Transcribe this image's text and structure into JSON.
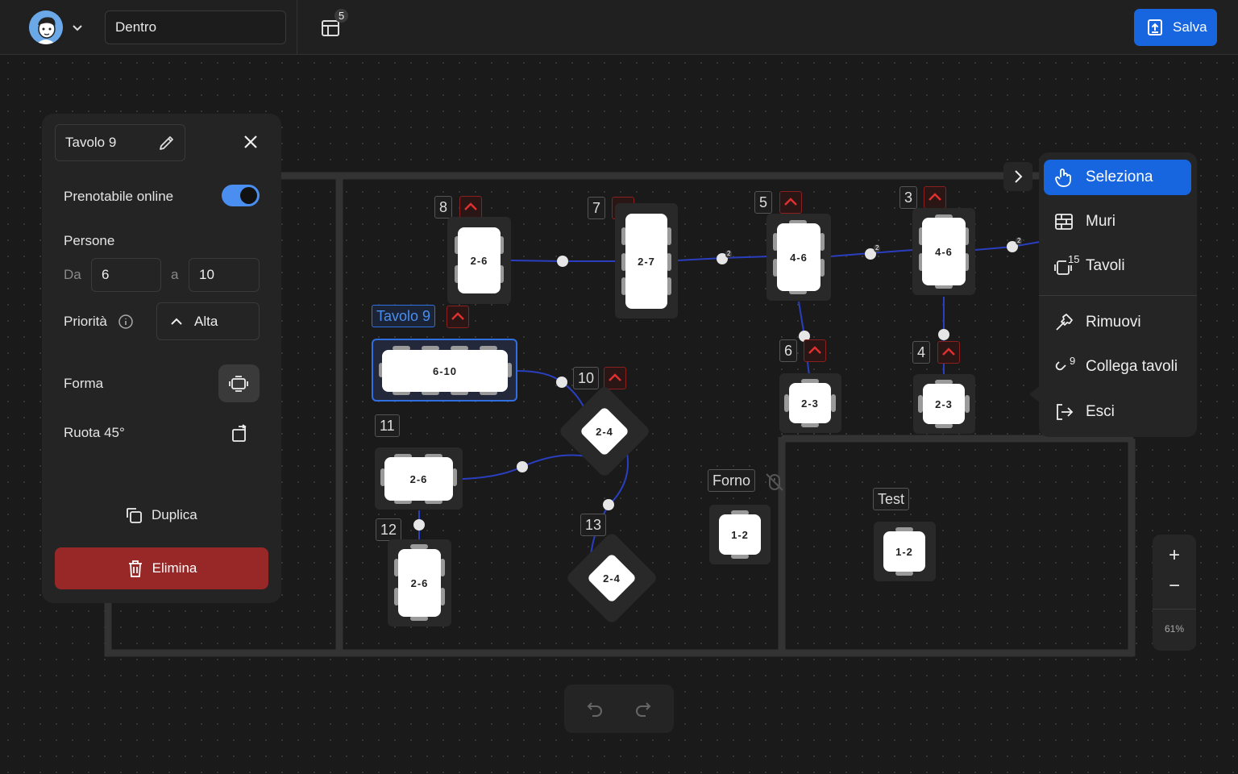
{
  "header": {
    "room_name": "Dentro",
    "layout_badge": "5",
    "save_label": "Salva"
  },
  "panel": {
    "table_name": "Tavolo 9",
    "online_label": "Prenotabile online",
    "online_enabled": true,
    "persons_label": "Persone",
    "from_label": "Da",
    "from_value": "6",
    "to_label": "a",
    "to_value": "10",
    "priority_label": "Priorità",
    "priority_value": "Alta",
    "shape_label": "Forma",
    "rotate_label": "Ruota 45°",
    "duplicate_label": "Duplica",
    "delete_label": "Elimina"
  },
  "floor": {
    "tables": [
      {
        "number": "8",
        "seats": "2-6"
      },
      {
        "number": "7",
        "seats": "2-7"
      },
      {
        "number": "5",
        "seats": "4-6"
      },
      {
        "number": "3",
        "seats": "4-6"
      },
      {
        "number": "Tavolo 9",
        "seats": "6-10"
      },
      {
        "number": "10",
        "seats": "2-4"
      },
      {
        "number": "11",
        "seats": "2-6"
      },
      {
        "number": "12",
        "seats": "2-6"
      },
      {
        "number": "13",
        "seats": "2-4"
      },
      {
        "number": "6",
        "seats": "2-3"
      },
      {
        "number": "4",
        "seats": "2-3"
      },
      {
        "number": "Forno",
        "seats": "1-2"
      },
      {
        "number": "Test",
        "seats": "1-2"
      }
    ],
    "link_badges": [
      "2",
      "2",
      "2",
      "2"
    ]
  },
  "menu": {
    "items": [
      {
        "label": "Seleziona"
      },
      {
        "label": "Muri"
      },
      {
        "label": "Tavoli",
        "count": "15"
      },
      {
        "label": "Rimuovi"
      },
      {
        "label": "Collega tavoli",
        "count": "9"
      },
      {
        "label": "Esci"
      }
    ]
  },
  "zoom": {
    "plus": "+",
    "minus": "−",
    "level": "61%"
  },
  "colors": {
    "accent": "#1766e0",
    "danger": "#982828",
    "link": "#2a3fbf"
  }
}
